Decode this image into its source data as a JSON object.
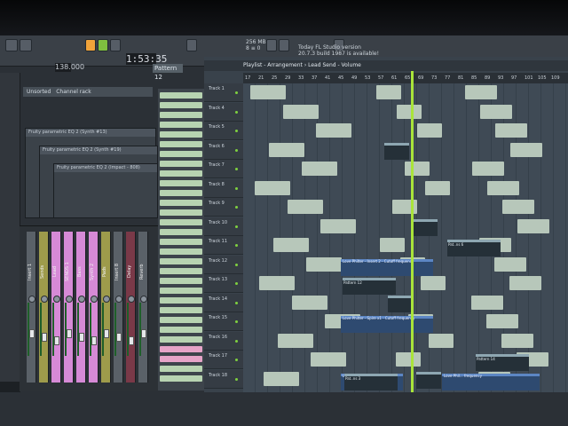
{
  "app": {
    "name": "FL Studio"
  },
  "toolbar": {
    "time_display": "1:53:35",
    "bpm": "138.000",
    "pattern_selector": "Pattern 12",
    "cpu_top": "256 MB",
    "cpu_bottom": "8 ≡ 0",
    "hint_line1": "Today FL Studio version",
    "hint_line2": "20.7.3 build 1987 is available!"
  },
  "channel_rack": {
    "title": "Channel rack",
    "prefix": "Unsorted",
    "windows": [
      {
        "title": "Fruity parametric EQ 2 (Synth #13)"
      },
      {
        "title": "Fruity parametric EQ 2 (Synth #19)"
      },
      {
        "title": "Fruity parametric EQ 2 (Impact - 808)"
      }
    ]
  },
  "mixer": {
    "strips": [
      {
        "label": "Insert 1",
        "color": "#5a6168"
      },
      {
        "label": "Sends",
        "color": "#9e9b4b"
      },
      {
        "label": "Lead",
        "color": "#d68ad6"
      },
      {
        "label": "SENDS 1",
        "color": "#d68ad6"
      },
      {
        "label": "Bass",
        "color": "#d68ad6"
      },
      {
        "label": "Synth 2",
        "color": "#d68ad6"
      },
      {
        "label": "Pads",
        "color": "#9e9b4b"
      },
      {
        "label": "Insert 8",
        "color": "#5a6168"
      },
      {
        "label": "Delay",
        "color": "#7a3948"
      },
      {
        "label": "Reverb",
        "color": "#5a6168"
      }
    ]
  },
  "patterns": {
    "count": 30
  },
  "playlist": {
    "title": "Playlist - Arrangement › Lead Send - Volume",
    "ruler": [
      "17",
      "21",
      "25",
      "29",
      "33",
      "37",
      "41",
      "45",
      "49",
      "53",
      "57",
      "61",
      "65",
      "69",
      "73",
      "77",
      "81",
      "85",
      "89",
      "93",
      "97",
      "101",
      "105",
      "109"
    ],
    "tracks": [
      "Track 1",
      "Track 4",
      "Track 5",
      "Track 6",
      "Track 7",
      "Track 8",
      "Track 9",
      "Track 10",
      "Track 11",
      "Track 12",
      "Track 13",
      "Track 14",
      "Track 15",
      "Track 16",
      "Track 17",
      "Track 18"
    ],
    "automation_clips": [
      {
        "label": "Love Philter - Insert 2 - Cutoff frequency"
      },
      {
        "label": "Love Philter - Spire x1 - Cutoff frequency"
      },
      {
        "label": "Love Phil... frequency"
      },
      {
        "label": "Love Phil... frequency"
      }
    ],
    "pattern_clips": [
      {
        "label": "Pattern 12"
      },
      {
        "label": "Pattern 14"
      },
      {
        "label": "Pat..ns 3"
      },
      {
        "label": "Pat..ns 6"
      }
    ]
  }
}
